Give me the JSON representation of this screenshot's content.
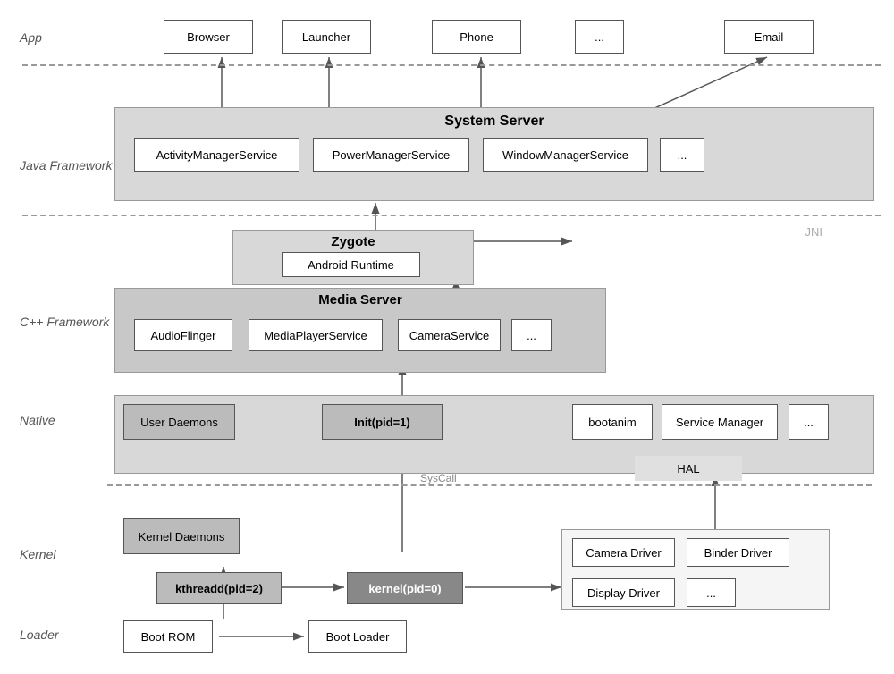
{
  "layers": {
    "app": "App",
    "java_framework": "Java Framework",
    "cpp_framework": "C++ Framework",
    "native": "Native",
    "kernel": "Kernel",
    "loader": "Loader"
  },
  "app_boxes": [
    "Browser",
    "Launcher",
    "Phone",
    "...",
    "Email"
  ],
  "system_server": {
    "title": "System Server",
    "services": [
      "ActivityManagerService",
      "PowerManagerService",
      "WindowManagerService",
      "..."
    ]
  },
  "zygote": {
    "title": "Zygote",
    "sub": "Android Runtime",
    "label": "JNI"
  },
  "media_server": {
    "title": "Media Server",
    "services": [
      "AudioFlinger",
      "MediaPlayerService",
      "CameraService",
      "..."
    ]
  },
  "native_items": {
    "user_daemons": "User Daemons",
    "init": "Init(pid=1)",
    "bootanim": "bootanim",
    "service_manager": "Service Manager",
    "dots": "...",
    "hal": "HAL",
    "syscall": "SysCall"
  },
  "kernel_items": {
    "kernel_daemons": "Kernel Daemons",
    "kthreadd": "kthreadd(pid=2)",
    "kernel": "kernel(pid=0)",
    "camera_driver": "Camera Driver",
    "binder_driver": "Binder Driver",
    "display_driver": "Display Driver",
    "dots": "..."
  },
  "loader_items": {
    "boot_rom": "Boot ROM",
    "boot_loader": "Boot Loader"
  }
}
